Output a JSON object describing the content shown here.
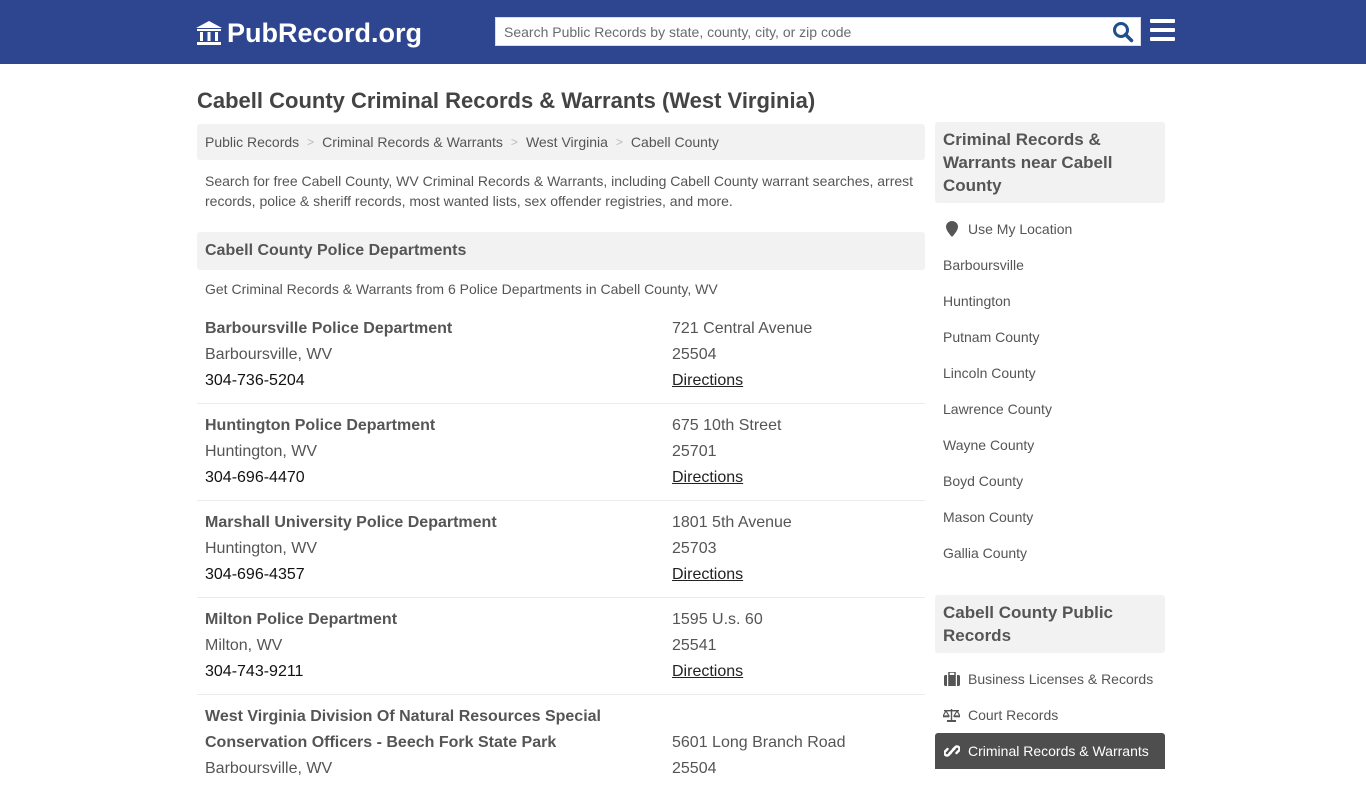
{
  "header": {
    "brand": "PubRecord.org",
    "search_placeholder": "Search Public Records by state, county, city, or zip code",
    "colors": {
      "navbar": "#2e4690",
      "search_icon": "#1f4f8f"
    }
  },
  "page": {
    "title": "Cabell County Criminal Records & Warrants (West Virginia)",
    "breadcrumb": [
      "Public Records",
      "Criminal Records & Warrants",
      "West Virginia",
      "Cabell County"
    ],
    "intro": "Search for free Cabell County, WV Criminal Records & Warrants, including Cabell County warrant searches, arrest records, police & sheriff records, most wanted lists, sex offender registries, and more."
  },
  "police": {
    "heading": "Cabell County Police Departments",
    "subheading": "Get Criminal Records & Warrants from 6 Police Departments in Cabell County, WV",
    "directions_label": "Directions",
    "departments": [
      {
        "name": "Barboursville Police Department",
        "city": "Barboursville, WV",
        "phone": "304-736-5204",
        "address": "721 Central Avenue",
        "zip": "25504"
      },
      {
        "name": "Huntington Police Department",
        "city": "Huntington, WV",
        "phone": "304-696-4470",
        "address": "675 10th Street",
        "zip": "25701"
      },
      {
        "name": "Marshall University Police Department",
        "city": "Huntington, WV",
        "phone": "304-696-4357",
        "address": "1801 5th Avenue",
        "zip": "25703"
      },
      {
        "name": "Milton Police Department",
        "city": "Milton, WV",
        "phone": "304-743-9211",
        "address": "1595 U.s. 60",
        "zip": "25541"
      },
      {
        "name_line1": "West Virginia Division Of Natural Resources Special",
        "name_line2": "Conservation Officers - Beech Fork State Park",
        "city": "Barboursville, WV",
        "address": "5601 Long Branch Road",
        "zip": "25504"
      }
    ]
  },
  "sidebar": {
    "nearby": {
      "heading": "Criminal Records & Warrants near Cabell County",
      "use_location": "Use My Location",
      "items": [
        "Barboursville",
        "Huntington",
        "Putnam County",
        "Lincoln County",
        "Lawrence County",
        "Wayne County",
        "Boyd County",
        "Mason County",
        "Gallia County"
      ]
    },
    "public_records": {
      "heading": "Cabell County Public Records",
      "items": [
        {
          "label": "Business Licenses & Records",
          "icon": "briefcase-icon"
        },
        {
          "label": "Court Records",
          "icon": "scale-icon"
        },
        {
          "label": "Criminal Records & Warrants",
          "icon": "link-icon",
          "active": true
        }
      ]
    }
  }
}
